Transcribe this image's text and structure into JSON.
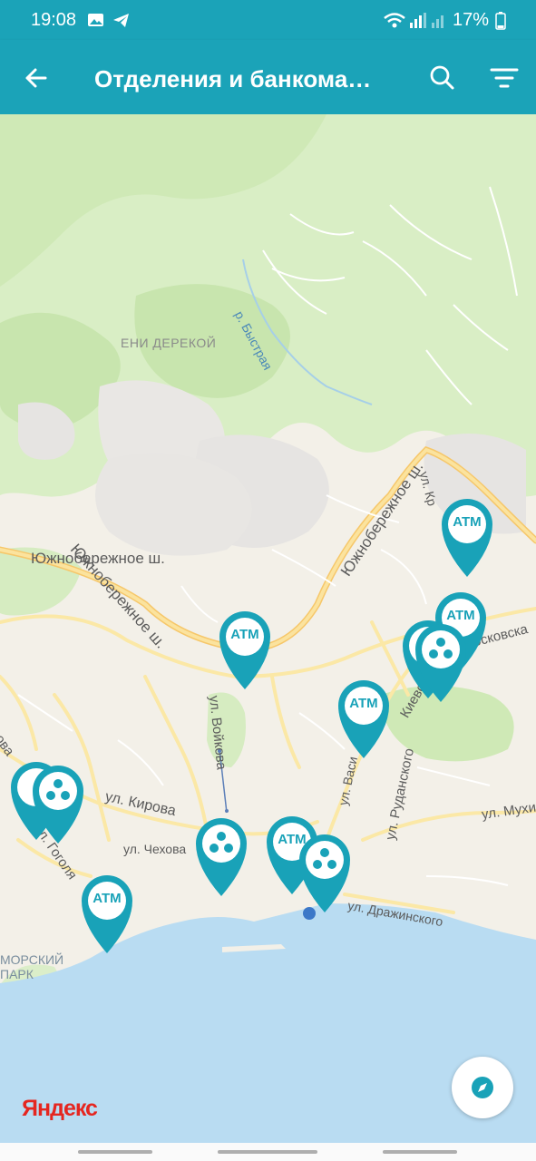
{
  "status_bar": {
    "time": "19:08",
    "battery": "17%"
  },
  "app_bar": {
    "title": "Отделения и банкоматы",
    "back_icon": "arrow-left-icon",
    "search_icon": "search-icon",
    "filter_icon": "filter-icon"
  },
  "map": {
    "provider_logo": "Яндекс",
    "labels": {
      "district": "ЕНИ ДЕРЕКОЙ",
      "river": "р. Быстрая",
      "road_a": "Южнобережное ш.",
      "road_b": "Южнобережное ш.",
      "road_c": "Южнобережное ш.",
      "ul_kr": "ул. Кр",
      "ul_moskovskaya": "осковска",
      "ul_voykova": "ул. Войкова",
      "ul_vasil": "ул. Васи",
      "ul_kievskaya": "Киевс",
      "ul_rudanskogo": "ул. Руданского",
      "ul_kirova": "ул. Кирова",
      "ul_chekhova": "ул. Чехова",
      "ul_gogolya": "ул. Гоголя",
      "ul_mukhina": "ул. Мухи",
      "ul_drazhinskogo": "ул. Дражинского",
      "ul_ova": "рова",
      "park": "МОРСКИЙ",
      "park2": "ПАРК"
    },
    "pins": {
      "atm": "ATM"
    }
  },
  "accent_color": "#19a2b8"
}
